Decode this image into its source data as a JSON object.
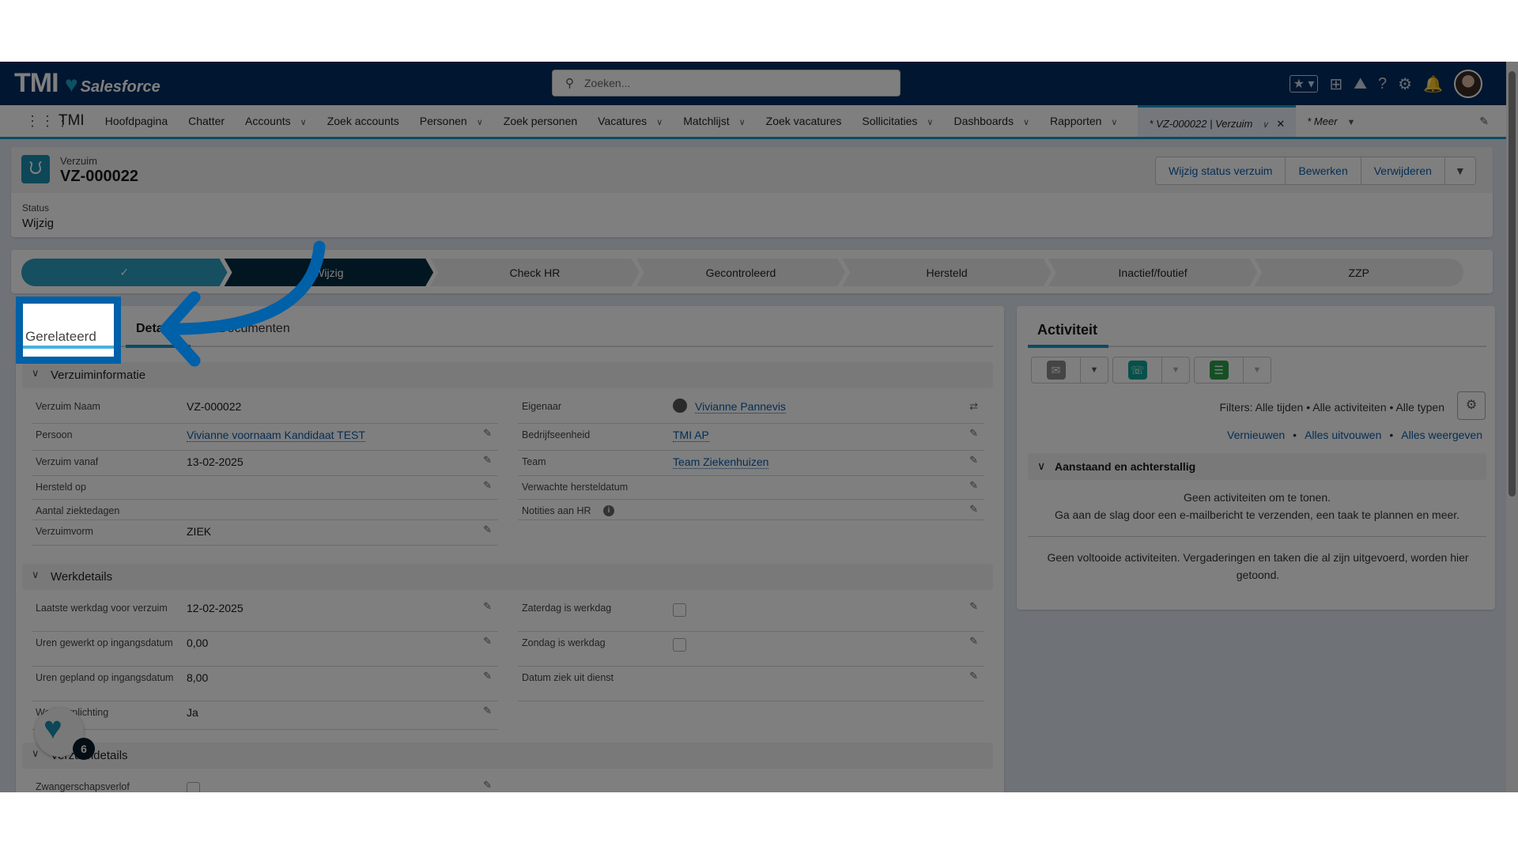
{
  "header": {
    "logo_text": "TMI",
    "logo_sub": "Salesforce",
    "search_placeholder": "Zoeken...",
    "icons": [
      "star-icon",
      "add-icon",
      "trailhead-icon",
      "help-icon",
      "gear-icon",
      "bell-icon",
      "avatar"
    ]
  },
  "nav": {
    "app_name": "TMI",
    "items": [
      {
        "label": "Hoofdpagina",
        "menu": false
      },
      {
        "label": "Chatter",
        "menu": false
      },
      {
        "label": "Accounts",
        "menu": true
      },
      {
        "label": "Zoek accounts",
        "menu": false
      },
      {
        "label": "Personen",
        "menu": true
      },
      {
        "label": "Zoek personen",
        "menu": false
      },
      {
        "label": "Vacatures",
        "menu": true
      },
      {
        "label": "Matchlijst",
        "menu": true
      },
      {
        "label": "Zoek vacatures",
        "menu": false
      },
      {
        "label": "Sollicitaties",
        "menu": true
      },
      {
        "label": "Dashboards",
        "menu": true
      },
      {
        "label": "Rapporten",
        "menu": true
      }
    ],
    "active_tab": "* VZ-000022 | Verzuim",
    "more": "* Meer"
  },
  "record": {
    "object": "Verzuim",
    "name": "VZ-000022",
    "buttons": [
      "Wijzig status verzuim",
      "Bewerken",
      "Verwijderen"
    ],
    "status_label": "Status",
    "status_value": "Wijzig"
  },
  "path": {
    "steps": [
      "✓",
      "Wijzig",
      "Check HR",
      "Gecontroleerd",
      "Hersteld",
      "Inactief/foutief",
      "ZZP"
    ],
    "completed_index": 0,
    "current_index": 1
  },
  "tabs": {
    "items": [
      "Gerelateerd",
      "Details",
      "Documenten"
    ],
    "active": "Details",
    "highlighted": "Gerelateerd"
  },
  "sections": {
    "info": {
      "title": "Verzuiminformatie",
      "left": [
        {
          "label": "Verzuim Naam",
          "value": "VZ-000022",
          "edit": false
        },
        {
          "label": "Persoon",
          "value": "Vivianne voornaam Kandidaat TEST",
          "link": true,
          "edit": true
        },
        {
          "label": "Verzuim vanaf",
          "value": "13-02-2025",
          "edit": true
        },
        {
          "label": "Hersteld op",
          "value": "",
          "edit": true
        },
        {
          "label": "Aantal ziektedagen",
          "value": "",
          "edit": false
        },
        {
          "label": "Verzuimvorm",
          "value": "ZIEK",
          "edit": true
        }
      ],
      "right": [
        {
          "label": "Eigenaar",
          "value": "Vivianne Pannevis",
          "link": true,
          "owner": true
        },
        {
          "label": "Bedrijfseenheid",
          "value": "TMI AP",
          "link": true,
          "edit": true
        },
        {
          "label": "Team",
          "value": "Team Ziekenhuizen",
          "link": true,
          "edit": true
        },
        {
          "label": "Verwachte hersteldatum",
          "value": "",
          "edit": true
        },
        {
          "label": "Notities aan HR",
          "value": "",
          "edit": true,
          "info": true
        }
      ]
    },
    "work": {
      "title": "Werkdetails",
      "left": [
        {
          "label": "Laatste werkdag voor verzuim",
          "value": "12-02-2025",
          "edit": true
        },
        {
          "label": "Uren gewerkt op ingangsdatum",
          "value": "0,00",
          "edit": true
        },
        {
          "label": "Uren gepland op ingangsdatum",
          "value": "8,00",
          "edit": true
        },
        {
          "label": "Werkverplichting",
          "value": "Ja",
          "edit": true
        }
      ],
      "right": [
        {
          "label": "Zaterdag is werkdag",
          "checkbox": true,
          "checked": false,
          "edit": true
        },
        {
          "label": "Zondag is werkdag",
          "checkbox": true,
          "checked": false,
          "edit": true
        },
        {
          "label": "Datum ziek uit dienst",
          "value": "",
          "edit": true
        }
      ]
    },
    "details": {
      "title": "Verzuimdetails",
      "left": [
        {
          "label": "Zwangerschapsverlof",
          "checkbox": true,
          "checked": false,
          "edit": true
        }
      ]
    }
  },
  "activity": {
    "title": "Activiteit",
    "filters": "Filters: Alle tijden • Alle activiteiten • Alle typen",
    "links": [
      "Vernieuwen",
      "Alles uitvouwen",
      "Alles weergeven"
    ],
    "section": "Aanstaand en achterstallig",
    "empty1": "Geen activiteiten om te tonen.",
    "empty2": "Ga aan de slag door een e-mailbericht te verzenden, een taak te plannen en meer.",
    "done": "Geen voltooide activiteiten. Vergaderingen en taken die al zijn uitgevoerd, worden hier getoond."
  },
  "widget": {
    "badge": "6"
  },
  "colors": {
    "header": "#032d60",
    "accent": "#1b96c8",
    "link": "#0b5cab",
    "highlight": "#0060a8",
    "path_done": "#2a9ec0",
    "path_current": "#032d40"
  }
}
